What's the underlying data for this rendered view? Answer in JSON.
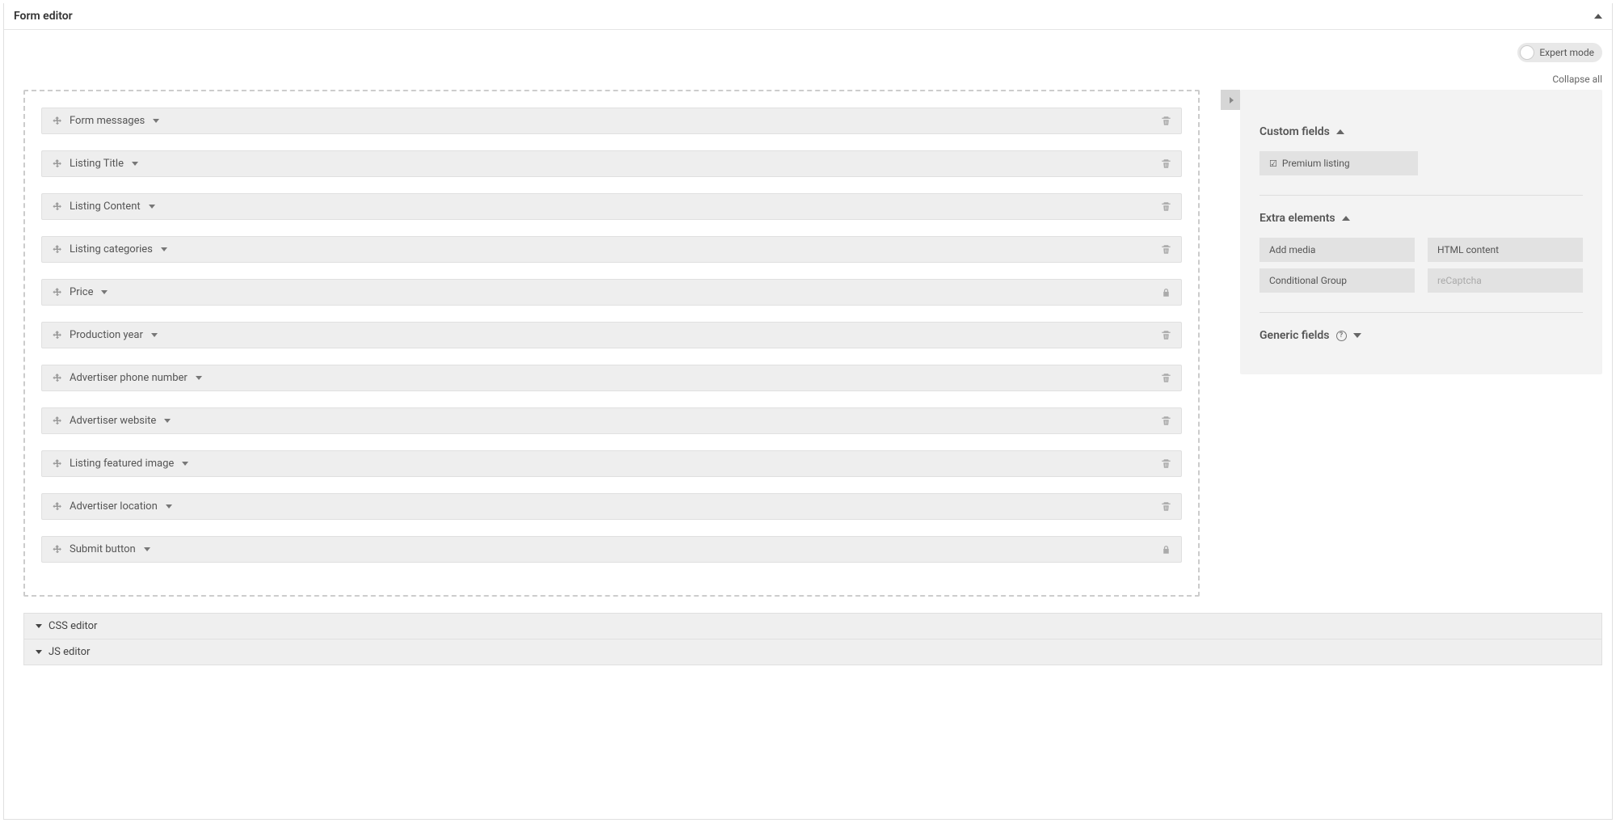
{
  "header": {
    "title": "Form editor"
  },
  "toolbar": {
    "expert_mode_label": "Expert mode",
    "collapse_all_label": "Collapse all"
  },
  "fields": [
    {
      "label": "Form messages",
      "locked": false
    },
    {
      "label": "Listing Title",
      "locked": false
    },
    {
      "label": "Listing Content",
      "locked": false
    },
    {
      "label": "Listing categories",
      "locked": false
    },
    {
      "label": "Price",
      "locked": true
    },
    {
      "label": "Production year",
      "locked": false
    },
    {
      "label": "Advertiser phone number",
      "locked": false
    },
    {
      "label": "Advertiser website",
      "locked": false
    },
    {
      "label": "Listing featured image",
      "locked": false
    },
    {
      "label": "Advertiser location",
      "locked": false
    },
    {
      "label": "Submit button",
      "locked": true
    }
  ],
  "sidebar": {
    "custom_fields_title": "Custom fields",
    "custom_fields_items": {
      "premium_listing": "Premium listing"
    },
    "extra_elements_title": "Extra elements",
    "extra_items": {
      "add_media": "Add media",
      "html_content": "HTML content",
      "conditional_group": "Conditional Group",
      "recaptcha": "reCaptcha"
    },
    "generic_fields_title": "Generic fields"
  },
  "editors": {
    "css": "CSS editor",
    "js": "JS editor"
  }
}
